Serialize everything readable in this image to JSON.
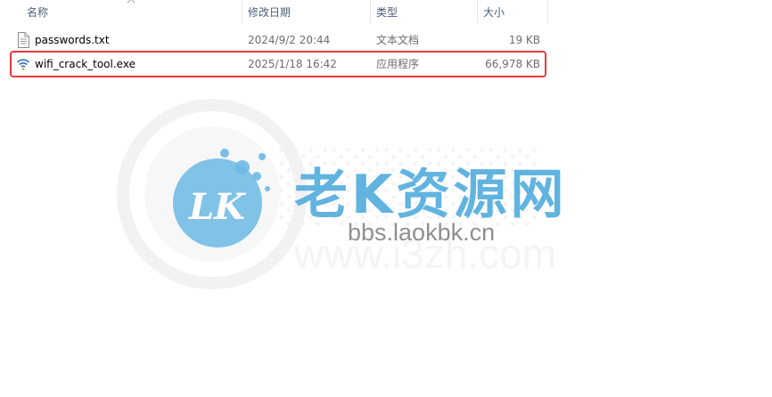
{
  "columns": {
    "name": "名称",
    "modified": "修改日期",
    "type": "类型",
    "size": "大小"
  },
  "files": [
    {
      "name": "passwords.txt",
      "modified": "2024/9/2 20:44",
      "type": "文本文档",
      "size": "19 KB",
      "icon": "text-file-icon"
    },
    {
      "name": "wifi_crack_tool.exe",
      "modified": "2025/1/18 16:42",
      "type": "应用程序",
      "size": "66,978 KB",
      "icon": "wifi-app-icon",
      "highlighted": true
    }
  ],
  "watermark": {
    "logo": "LK",
    "title": "老K资源网",
    "url": "bbs.laokbk.cn",
    "ghost_url": "www.i3zh.com"
  },
  "colors": {
    "highlight_border": "#e53a3a",
    "watermark_blue": "#61b3e0",
    "header_text": "#4c607a"
  }
}
